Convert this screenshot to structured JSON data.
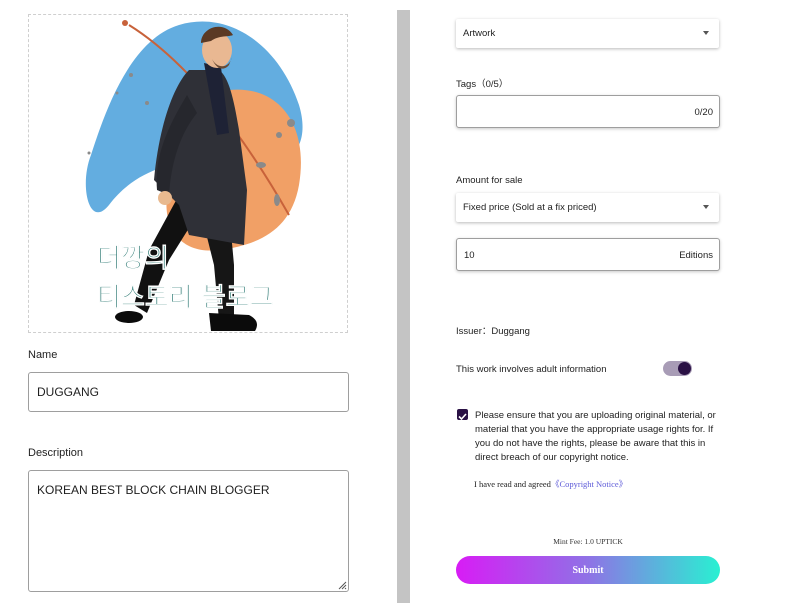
{
  "colors": {
    "accent_dark": "#2a1145",
    "toggle_track": "#a89cb6",
    "submit_gradient_start": "#d81cf5",
    "submit_gradient_end": "#29f0d2",
    "link": "#5d5ad8",
    "art_blob_blue": "#63ade0",
    "art_blob_orange": "#f1a066",
    "art_text": "#2e7a74"
  },
  "artwork": {
    "line1": "더깡의",
    "line2": "티스토리 블로그"
  },
  "form": {
    "name_label": "Name",
    "name_value": "DUGGANG",
    "description_label": "Description",
    "description_value": "KOREAN BEST BLOCK CHAIN BLOGGER"
  },
  "settings": {
    "category_value": "Artwork",
    "tags_label": "Tags（0/5）",
    "tags_counter": "0/20",
    "amount_label": "Amount for sale",
    "sale_type_value": "Fixed price (Sold at a fix priced)",
    "editions_value": "10",
    "editions_suffix": "Editions",
    "issuer_text": "Issuer：Duggang",
    "adult_label": "This work involves adult information",
    "adult_enabled": true,
    "rights_checked": true,
    "rights_notice": "Please ensure that you are uploading original material, or material that you have the appropriate usage rights for. If you do not have the rights, please be aware that this in direct breach of our copyright notice.",
    "agree_text": "I have read and agreed",
    "copyright_link": "《Copyright Notice》",
    "mint_fee": "Mint Fee: 1.0 UPTICK",
    "submit_label": "Submit"
  },
  "icons": {
    "select_caret": "caret-down-icon",
    "checkbox": "check-icon",
    "resize": "resize-handle-icon"
  }
}
